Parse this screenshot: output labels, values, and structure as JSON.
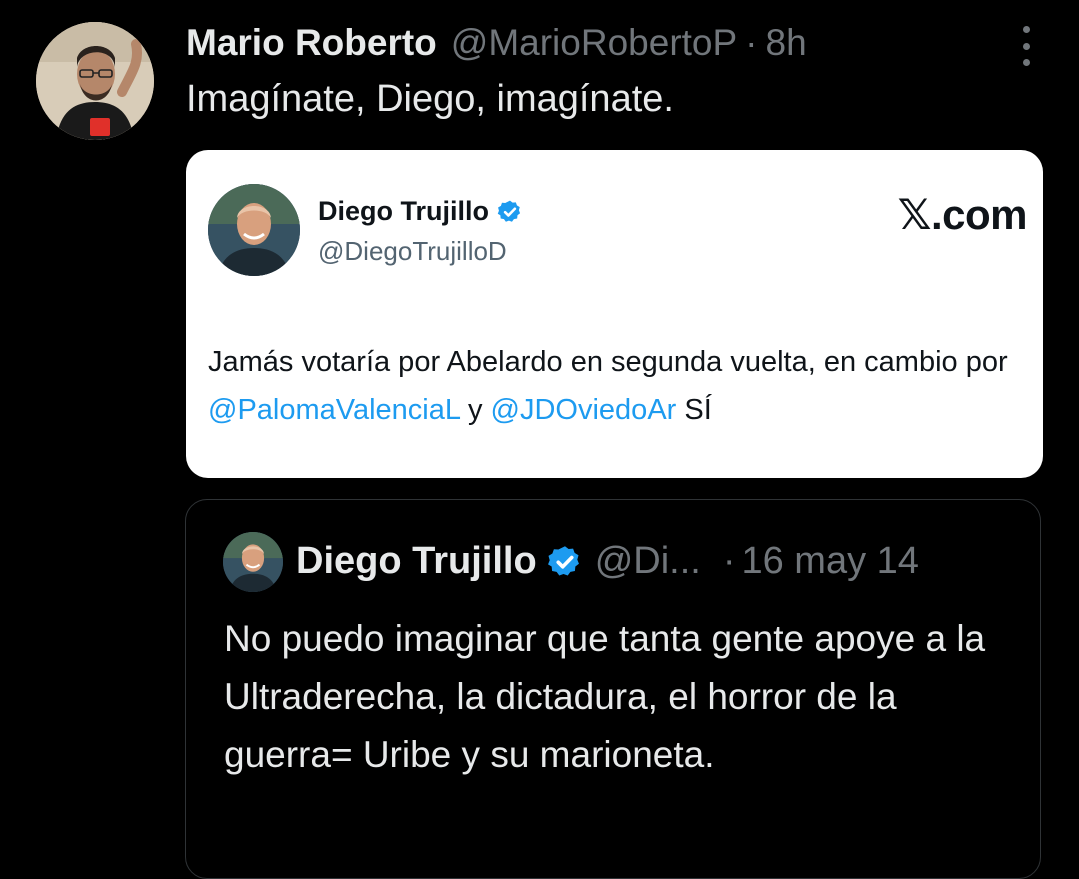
{
  "post": {
    "author_name": "Mario Roberto",
    "handle": "@MarioRobertoP",
    "separator": "·",
    "time": "8h",
    "text": "Imagínate, Diego, imagínate."
  },
  "image_card": {
    "author_name": "Diego Trujillo",
    "handle": "@DiegoTrujilloD",
    "brand": "𝕏.com",
    "text_part1": "Jamás votaría por Abelardo en segunda vuelta, en cambio por ",
    "mention1": "@PalomaValenciaL",
    "text_part2": " y ",
    "mention2": "@JDOviedoAr",
    "text_part3": "  SÍ"
  },
  "quote": {
    "author_name": "Diego Trujillo",
    "handle": "@Di...",
    "separator": "·",
    "date": "16 may 14",
    "text": "No puedo imaginar que tanta gente apoye a la Ultraderecha, la dictadura, el horror de la guerra= Uribe y su marioneta."
  },
  "colors": {
    "background": "#000000",
    "verified_badge": "#1d9bf0",
    "mention": "#1d9bf0",
    "secondary_text": "#71767b"
  },
  "icons": [
    "avatar-mario",
    "more-options-icon",
    "verified-badge-icon",
    "avatar-diego"
  ]
}
